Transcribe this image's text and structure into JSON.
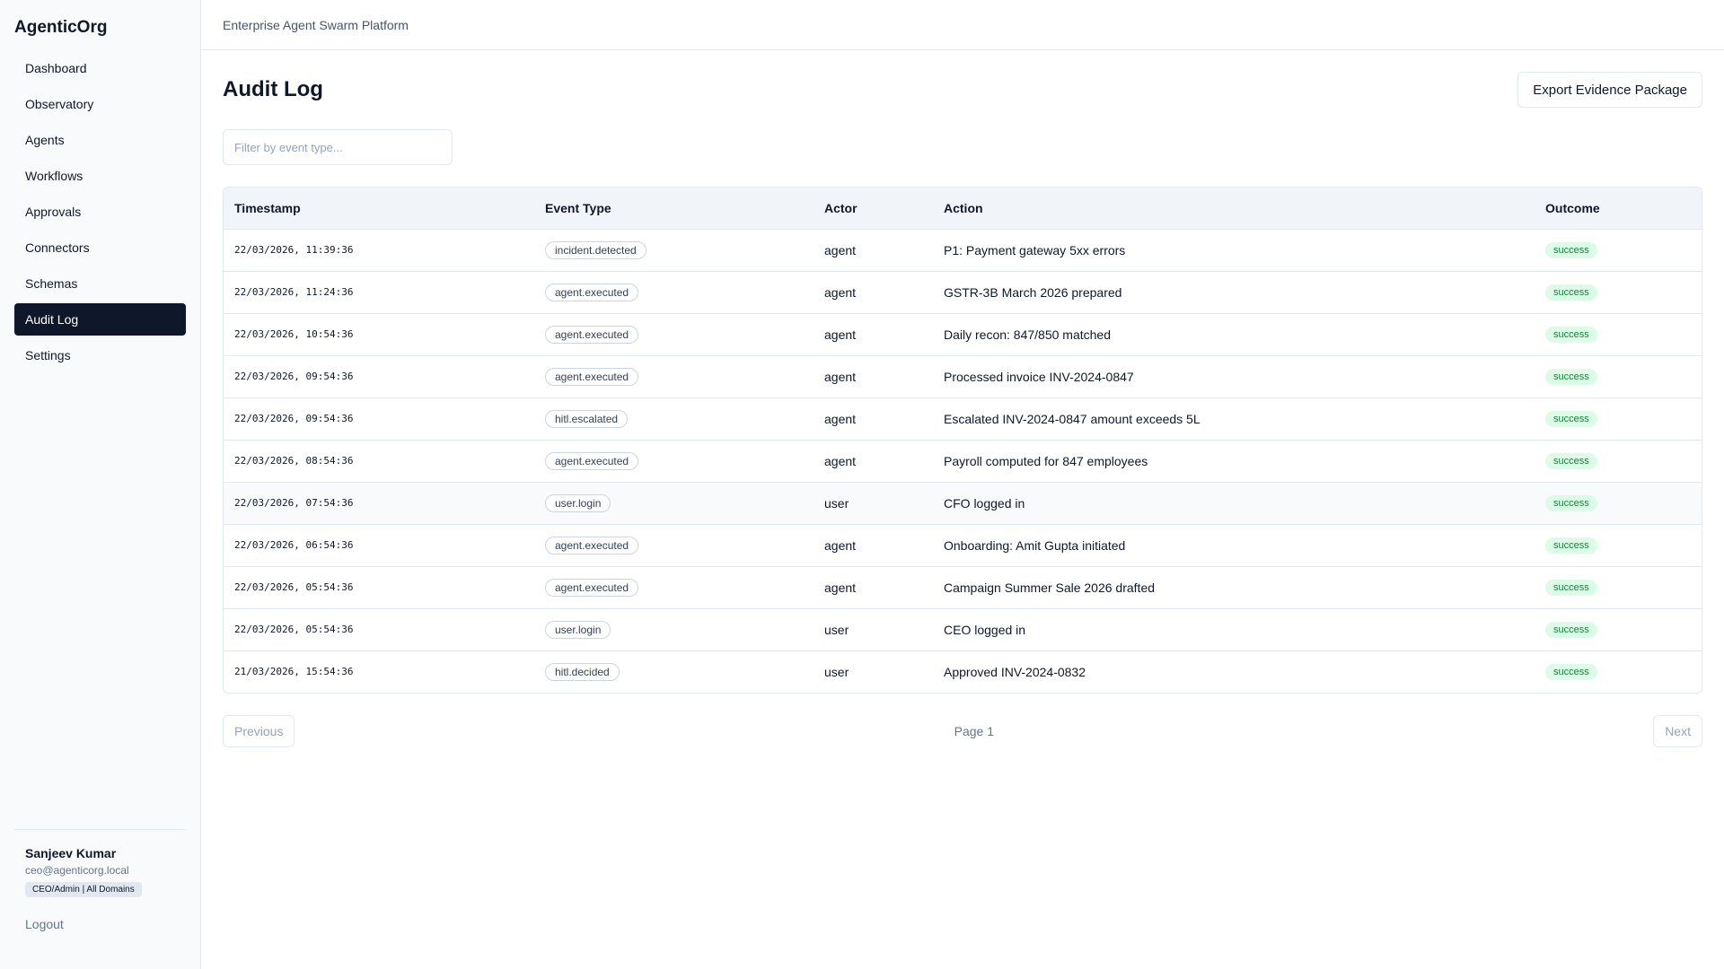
{
  "app": {
    "brand": "AgenticOrg",
    "subtitle": "Enterprise Agent Swarm Platform"
  },
  "sidebar": {
    "items": [
      {
        "label": "Dashboard"
      },
      {
        "label": "Observatory"
      },
      {
        "label": "Agents"
      },
      {
        "label": "Workflows"
      },
      {
        "label": "Approvals"
      },
      {
        "label": "Connectors"
      },
      {
        "label": "Schemas"
      },
      {
        "label": "Audit Log",
        "active": true
      },
      {
        "label": "Settings"
      }
    ],
    "user": {
      "name": "Sanjeev Kumar",
      "email": "ceo@agenticorg.local",
      "role": "CEO/Admin | All Domains"
    },
    "logout_label": "Logout"
  },
  "page": {
    "title": "Audit Log",
    "export_label": "Export Evidence Package",
    "filter_placeholder": "Filter by event type..."
  },
  "table": {
    "headers": {
      "timestamp": "Timestamp",
      "event_type": "Event Type",
      "actor": "Actor",
      "action": "Action",
      "outcome": "Outcome"
    },
    "rows": [
      {
        "timestamp": "22/03/2026, 11:39:36",
        "event_type": "incident.detected",
        "actor": "agent",
        "action": "P1: Payment gateway 5xx errors",
        "outcome": "success"
      },
      {
        "timestamp": "22/03/2026, 11:24:36",
        "event_type": "agent.executed",
        "actor": "agent",
        "action": "GSTR-3B March 2026 prepared",
        "outcome": "success"
      },
      {
        "timestamp": "22/03/2026, 10:54:36",
        "event_type": "agent.executed",
        "actor": "agent",
        "action": "Daily recon: 847/850 matched",
        "outcome": "success"
      },
      {
        "timestamp": "22/03/2026, 09:54:36",
        "event_type": "agent.executed",
        "actor": "agent",
        "action": "Processed invoice INV-2024-0847",
        "outcome": "success"
      },
      {
        "timestamp": "22/03/2026, 09:54:36",
        "event_type": "hitl.escalated",
        "actor": "agent",
        "action": "Escalated INV-2024-0847 amount exceeds 5L",
        "outcome": "success"
      },
      {
        "timestamp": "22/03/2026, 08:54:36",
        "event_type": "agent.executed",
        "actor": "agent",
        "action": "Payroll computed for 847 employees",
        "outcome": "success"
      },
      {
        "timestamp": "22/03/2026, 07:54:36",
        "event_type": "user.login",
        "actor": "user",
        "action": "CFO logged in",
        "outcome": "success"
      },
      {
        "timestamp": "22/03/2026, 06:54:36",
        "event_type": "agent.executed",
        "actor": "agent",
        "action": "Onboarding: Amit Gupta initiated",
        "outcome": "success"
      },
      {
        "timestamp": "22/03/2026, 05:54:36",
        "event_type": "agent.executed",
        "actor": "agent",
        "action": "Campaign Summer Sale 2026 drafted",
        "outcome": "success"
      },
      {
        "timestamp": "22/03/2026, 05:54:36",
        "event_type": "user.login",
        "actor": "user",
        "action": "CEO logged in",
        "outcome": "success"
      },
      {
        "timestamp": "21/03/2026, 15:54:36",
        "event_type": "hitl.decided",
        "actor": "user",
        "action": "Approved INV-2024-0832",
        "outcome": "success"
      }
    ]
  },
  "pagination": {
    "previous_label": "Previous",
    "page_label": "Page 1",
    "next_label": "Next"
  }
}
